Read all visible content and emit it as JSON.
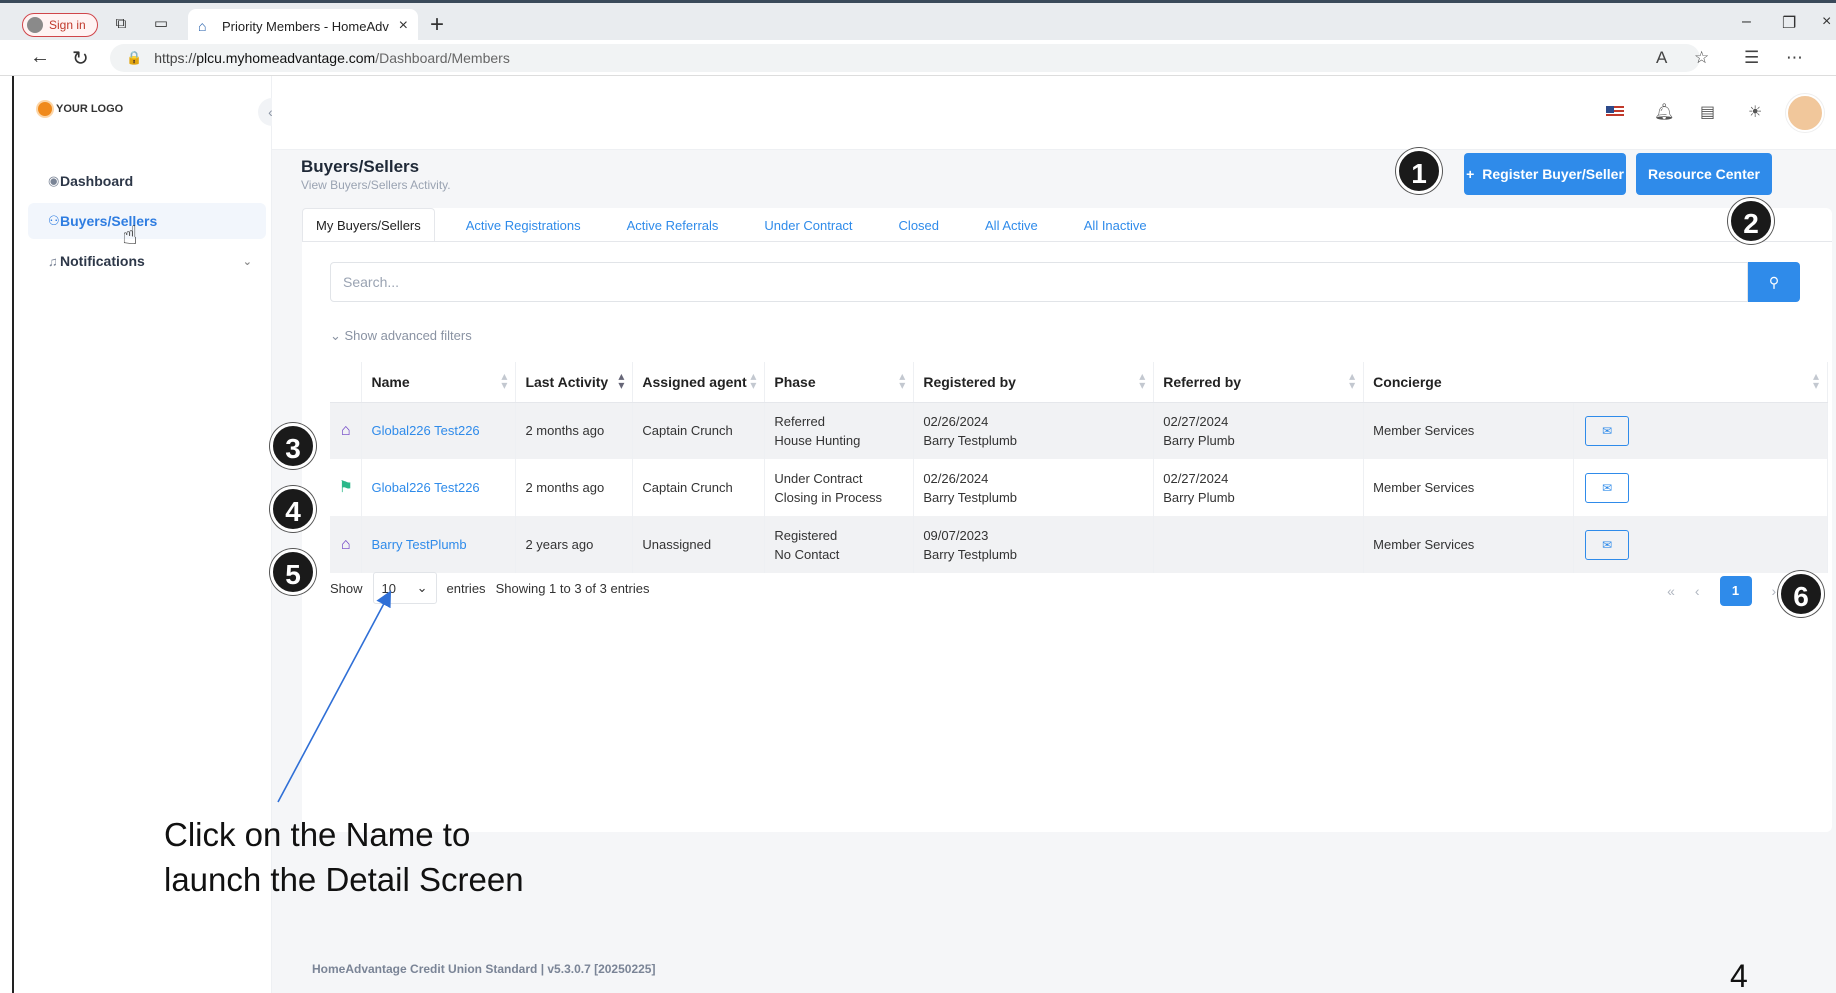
{
  "browser": {
    "signin_label": "Sign in",
    "tab_title": "Priority Members - HomeAdvanta",
    "url_scheme": "https://",
    "url_host": "plcu.myhomeadvantage.com",
    "url_path": "/Dashboard/Members"
  },
  "app": {
    "logo_text": "YOUR LOGO",
    "sidebar": [
      {
        "label": "Dashboard",
        "icon": "gauge-icon"
      },
      {
        "label": "Buyers/Sellers",
        "icon": "people-icon",
        "active": true
      },
      {
        "label": "Notifications",
        "icon": "bell-icon"
      }
    ]
  },
  "page": {
    "title": "Buyers/Sellers",
    "subtitle": "View Buyers/Sellers Activity.",
    "register_btn": "Register Buyer/Seller",
    "resource_btn": "Resource Center"
  },
  "tabs": [
    "My Buyers/Sellers",
    "Active Registrations",
    "Active Referrals",
    "Under Contract",
    "Closed",
    "All Active",
    "All Inactive"
  ],
  "search": {
    "placeholder": "Search..."
  },
  "advanced_filters": "Show advanced filters",
  "table": {
    "headers": [
      "Name",
      "Last Activity",
      "Assigned agent",
      "Phase",
      "Registered by",
      "Referred by",
      "Concierge"
    ],
    "rows": [
      {
        "icon": "house-icon",
        "icon_color": "#6b3fc4",
        "name": "Global226 Test226",
        "last_activity": "2 months ago",
        "agent": "Captain Crunch",
        "phase1": "Referred",
        "phase2": "House Hunting",
        "reg_date": "02/26/2024",
        "reg_by": "Barry Testplumb",
        "ref_date": "02/27/2024",
        "ref_by": "Barry Plumb",
        "concierge": "Member Services"
      },
      {
        "icon": "flag-icon",
        "icon_color": "#2bb88a",
        "name": "Global226 Test226",
        "last_activity": "2 months ago",
        "agent": "Captain Crunch",
        "phase1": "Under Contract",
        "phase2": "Closing in Process",
        "reg_date": "02/26/2024",
        "reg_by": "Barry Testplumb",
        "ref_date": "02/27/2024",
        "ref_by": "Barry Plumb",
        "concierge": "Member Services"
      },
      {
        "icon": "house-icon",
        "icon_color": "#6b3fc4",
        "name": "Barry TestPlumb",
        "last_activity": "2 years ago",
        "agent": "Unassigned",
        "phase1": "Registered",
        "phase2": "No Contact",
        "reg_date": "09/07/2023",
        "reg_by": "Barry Testplumb",
        "ref_date": "",
        "ref_by": "",
        "concierge": "Member Services"
      }
    ]
  },
  "pagination": {
    "show": "Show",
    "page_size": "10",
    "entries": "entries",
    "summary": "Showing 1 to 3 of 3 entries",
    "current_page": "1"
  },
  "footer": "HomeAdvantage Credit Union Standard | v5.3.0.7 [20250225]",
  "annotations": {
    "badges": [
      "1",
      "2",
      "3",
      "4",
      "5",
      "6"
    ],
    "callout_line1": "Click on the Name to",
    "callout_line2": "launch the Detail Screen",
    "page_number": "4"
  },
  "colors": {
    "primary": "#2f8bea",
    "house": "#6b3fc4",
    "flag": "#2bb88a"
  }
}
